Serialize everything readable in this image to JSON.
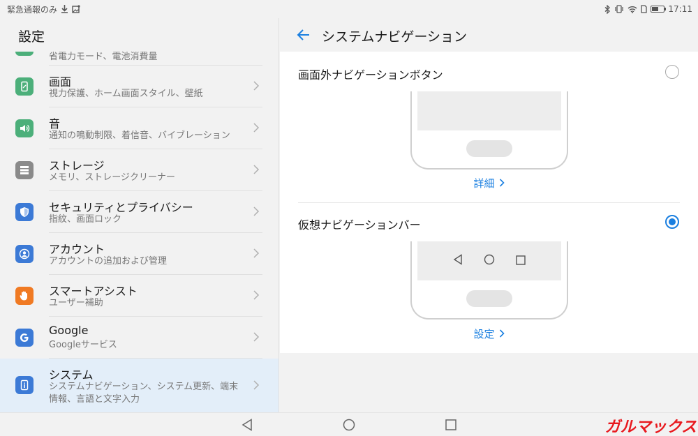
{
  "status_bar": {
    "left_text": "緊急通報のみ",
    "time": "17:11",
    "battery_level": 0.55
  },
  "settings": {
    "title": "設定",
    "peek_subtitle": "省電力モード、電池消費量",
    "items": [
      {
        "title": "画面",
        "subtitle": "視力保護、ホーム画面スタイル、壁紙",
        "icon": "display-icon",
        "color": "#4caf7a"
      },
      {
        "title": "音",
        "subtitle": "通知の鳴動制限、着信音、バイブレーション",
        "icon": "speaker-icon",
        "color": "#4caf7a"
      },
      {
        "title": "ストレージ",
        "subtitle": "メモリ、ストレージクリーナー",
        "icon": "storage-icon",
        "color": "#8a8a8a"
      },
      {
        "title": "セキュリティとプライバシー",
        "subtitle": "指紋、画面ロック",
        "icon": "shield-icon",
        "color": "#3c7ad6"
      },
      {
        "title": "アカウント",
        "subtitle": "アカウントの追加および管理",
        "icon": "account-icon",
        "color": "#3c7ad6"
      },
      {
        "title": "スマートアシスト",
        "subtitle": "ユーザー補助",
        "icon": "hand-icon",
        "color": "#f07a23"
      },
      {
        "title": "Google",
        "subtitle": "Googleサービス",
        "icon": "google-icon",
        "color": "#3c7ad6"
      },
      {
        "title": "システム",
        "subtitle": "システムナビゲーション、システム更新、端末情報、言語と文字入力",
        "icon": "info-icon",
        "color": "#3c7ad6",
        "selected": true
      }
    ]
  },
  "detail": {
    "title": "システムナビゲーション",
    "options": [
      {
        "label": "画面外ナビゲーションボタン",
        "selected": false,
        "link": "詳細"
      },
      {
        "label": "仮想ナビゲーションバー",
        "selected": true,
        "link": "設定"
      }
    ]
  },
  "watermark": "ガルマックス",
  "colors": {
    "accent": "#1a7fe0",
    "selected_row": "#e3eef9",
    "watermark": "#e8191e"
  }
}
